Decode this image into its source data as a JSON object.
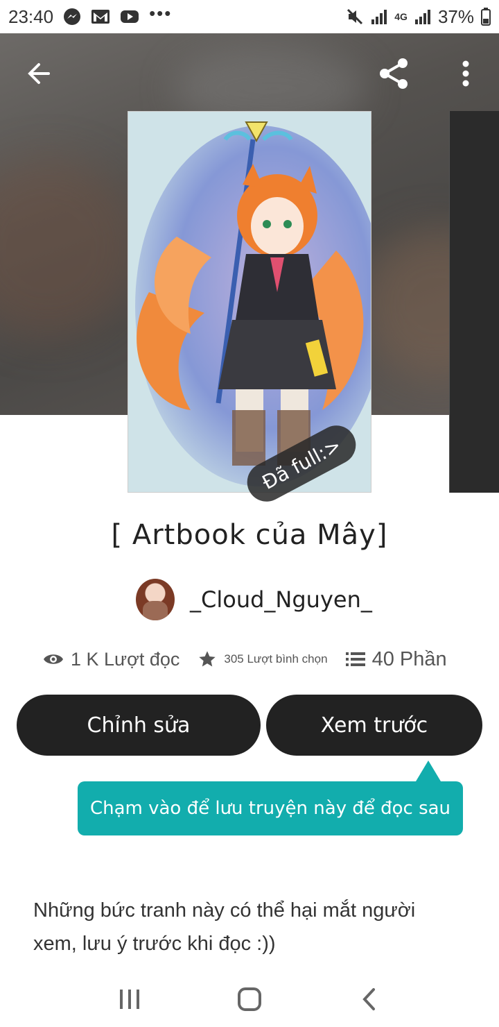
{
  "status_bar": {
    "time": "23:40",
    "network": "4G",
    "battery": "37%",
    "more_dots": "•••",
    "icons": [
      "messenger-icon",
      "gmail-icon",
      "youtube-icon",
      "mute-icon",
      "signal-icon",
      "battery-icon"
    ]
  },
  "header": {
    "back_icon": "arrow-left-icon",
    "share_icon": "share-icon",
    "menu_icon": "more-vertical-icon"
  },
  "cover": {
    "badge": "Đã full:>"
  },
  "story": {
    "title": "[ Artbook của Mây]",
    "author": "_Cloud_Nguyen_",
    "reads": "1 K Lượt đọc",
    "votes": "305 Lượt bình chọn",
    "parts": "40 Phần"
  },
  "actions": {
    "edit_label": "Chỉnh sửa",
    "preview_label": "Xem trước"
  },
  "tooltip": {
    "text": "Chạm vào để lưu truyện này để đọc sau"
  },
  "description": {
    "text": "Những bức tranh này có thể hại mắt người xem, lưu ý trước khi đọc :))"
  },
  "colors": {
    "button_bg": "#222222",
    "tooltip_bg": "#12adad",
    "status_text": "#333333"
  }
}
